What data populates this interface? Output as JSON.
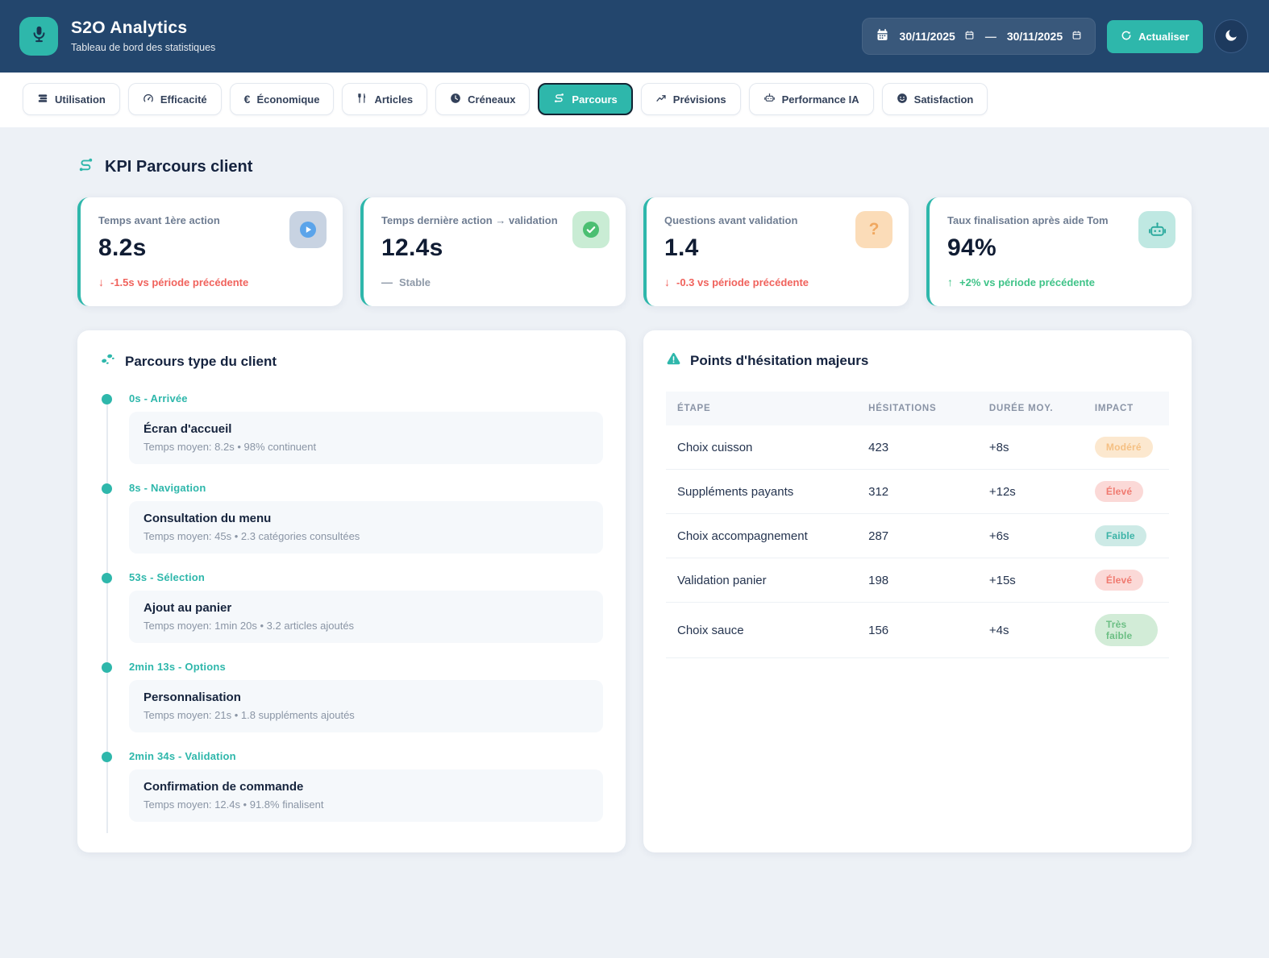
{
  "colors": {
    "header_bg": "#23466d",
    "accent_teal": "#2eb7ab",
    "page_bg": "#edf1f6",
    "negative_red": "#f0625c",
    "positive_green": "#3fc388",
    "neutral_grey": "#8e99a8",
    "badge_moderate_bg": "#fce8cf",
    "badge_high_bg": "#fbd9d7",
    "badge_low_bg": "#cdeae6",
    "badge_very_low_bg": "#d2ecd7"
  },
  "header": {
    "app_title": "S2O Analytics",
    "app_subtitle": "Tableau de bord des statistiques",
    "date_from": "30/11/2025",
    "date_separator": "—",
    "date_to": "30/11/2025",
    "refresh_label": "Actualiser"
  },
  "tabs": [
    {
      "label": "Utilisation",
      "icon": "usage-icon",
      "active": false
    },
    {
      "label": "Efficacité",
      "icon": "gauge-icon",
      "active": false
    },
    {
      "label": "Économique",
      "icon": "euro-icon",
      "active": false
    },
    {
      "label": "Articles",
      "icon": "utensils-icon",
      "active": false
    },
    {
      "label": "Créneaux",
      "icon": "clock-icon",
      "active": false
    },
    {
      "label": "Parcours",
      "icon": "route-icon",
      "active": true
    },
    {
      "label": "Prévisions",
      "icon": "trend-chart-icon",
      "active": false
    },
    {
      "label": "Performance IA",
      "icon": "robot-icon",
      "active": false
    },
    {
      "label": "Satisfaction",
      "icon": "smiley-icon",
      "active": false
    }
  ],
  "section": {
    "title": "KPI Parcours client"
  },
  "kpi_cards": [
    {
      "label": "Temps avant 1ère action",
      "value": "8.2s",
      "delta_symbol": "↓",
      "delta": "-1.5s vs période précédente",
      "trend": "down",
      "icon": "play-circle-icon"
    },
    {
      "label": "Temps dernière action → validation",
      "value": "12.4s",
      "delta_symbol": "—",
      "delta": "Stable",
      "trend": "stable",
      "icon": "check-circle-icon"
    },
    {
      "label": "Questions avant validation",
      "value": "1.4",
      "delta_symbol": "↓",
      "delta": "-0.3 vs période précédente",
      "trend": "down",
      "icon": "question-icon",
      "icon_glyph": "?"
    },
    {
      "label": "Taux finalisation après aide Tom",
      "value": "94%",
      "delta_symbol": "↑",
      "delta": "+2% vs période précédente",
      "trend": "up",
      "icon": "robot-icon"
    }
  ],
  "journey": {
    "title": "Parcours type du client",
    "steps": [
      {
        "time_label": "0s - Arrivée",
        "title": "Écran d'accueil",
        "detail": "Temps moyen: 8.2s • 98% continuent"
      },
      {
        "time_label": "8s - Navigation",
        "title": "Consultation du menu",
        "detail": "Temps moyen: 45s • 2.3 catégories consultées"
      },
      {
        "time_label": "53s - Sélection",
        "title": "Ajout au panier",
        "detail": "Temps moyen: 1min 20s • 3.2 articles ajoutés"
      },
      {
        "time_label": "2min 13s - Options",
        "title": "Personnalisation",
        "detail": "Temps moyen: 21s • 1.8 suppléments ajoutés"
      },
      {
        "time_label": "2min 34s - Validation",
        "title": "Confirmation de commande",
        "detail": "Temps moyen: 12.4s • 91.8% finalisent"
      }
    ]
  },
  "hesitations": {
    "title": "Points d'hésitation majeurs",
    "columns": [
      "ÉTAPE",
      "HÉSITATIONS",
      "DURÉE MOY.",
      "IMPACT"
    ],
    "rows": [
      {
        "etape": "Choix cuisson",
        "hesitations": "423",
        "duree": "+8s",
        "impact": "Modéré",
        "impact_level": "moderate"
      },
      {
        "etape": "Suppléments payants",
        "hesitations": "312",
        "duree": "+12s",
        "impact": "Élevé",
        "impact_level": "high"
      },
      {
        "etape": "Choix accompagnement",
        "hesitations": "287",
        "duree": "+6s",
        "impact": "Faible",
        "impact_level": "low"
      },
      {
        "etape": "Validation panier",
        "hesitations": "198",
        "duree": "+15s",
        "impact": "Élevé",
        "impact_level": "high"
      },
      {
        "etape": "Choix sauce",
        "hesitations": "156",
        "duree": "+4s",
        "impact": "Très faible",
        "impact_level": "very_low"
      }
    ]
  }
}
